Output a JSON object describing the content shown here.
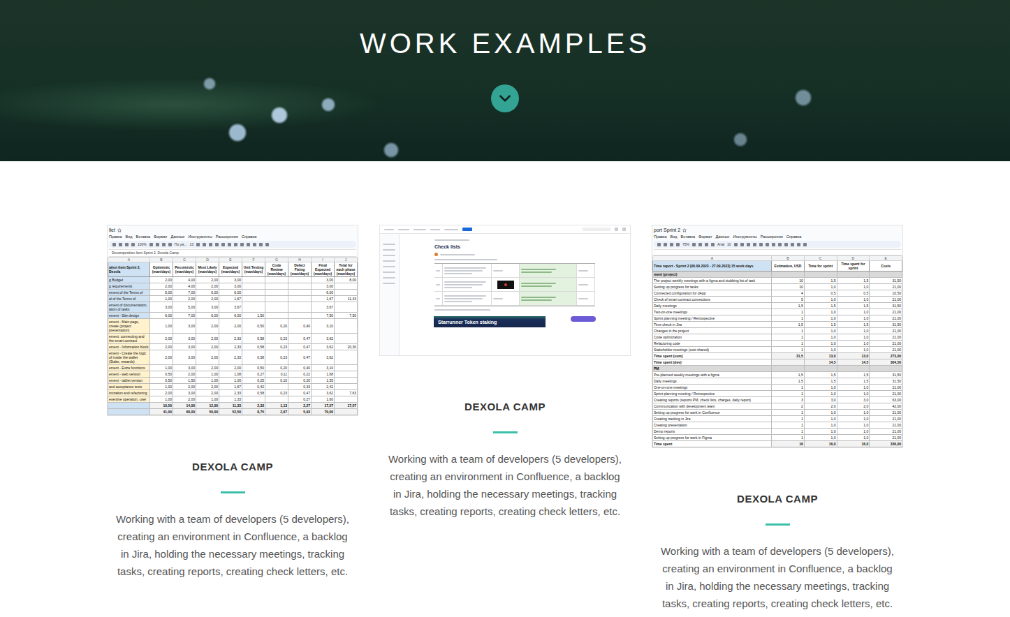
{
  "hero": {
    "title": "WORK EXAMPLES"
  },
  "cards": [
    {
      "title": "DEXOLA CAMP",
      "description": "Working with a team of developers (5 developers), creating an environment in Confluence, a backlog in Jira, holding the necessary meetings, tracking tasks, creating reports, creating check letters, etc.",
      "image": {
        "kind": "sheet",
        "tab": "llet",
        "menu": [
          "Правка",
          "Вид",
          "Вставка",
          "Формат",
          "Данные",
          "Инструменты",
          "Расширения",
          "Справка"
        ],
        "toolbar": {
          "zoom": "100%",
          "font": "По ум...",
          "size": "10"
        },
        "formula": "Decomposition Item Sprint 2, Dexola Camp",
        "letters": [
          "A",
          "B",
          "C",
          "D",
          "E",
          "F",
          "G",
          "H",
          "I",
          "J"
        ],
        "header": [
          "ation Item Sprint 2, Dexola",
          "Optimistic (man/days)",
          "Pessimistic (man/days)",
          "Most Likely (man/days)",
          "Expected (man/days)",
          "Unit Testing (man/days)",
          "Code Review (man/days)",
          "Defect Fixing (man/days)",
          "Final Expected (man/days)",
          "Total for each phase (man/days)"
        ],
        "rows": [
          {
            "kind": "item",
            "color": "#cfe2f3",
            "cells": [
              "g Budget",
              "2,00",
              "4,00",
              "2,00",
              "3,00",
              "",
              "",
              "",
              "3,00",
              "8,00"
            ]
          },
          {
            "kind": "item",
            "color": "#cfe2f3",
            "cells": [
              "g requirements",
              "2,00",
              "4,00",
              "2,00",
              "3,00",
              "",
              "",
              "",
              "3,00",
              ""
            ]
          },
          {
            "kind": "item",
            "color": "#cfe2f3",
            "cells": [
              "ement of the Terms of",
              "5,00",
              "7,00",
              "6,00",
              "6,00",
              "",
              "",
              "",
              "6,00",
              ""
            ]
          },
          {
            "kind": "item",
            "color": "#cfe2f3",
            "cells": [
              "al of the Terms of",
              "1,00",
              "2,00",
              "2,00",
              "1,67",
              "",
              "",
              "",
              "1,67",
              "11,33"
            ]
          },
          {
            "kind": "item",
            "color": "#cfe2f3",
            "cells": [
              "ement of documentation, ation of tasks",
              "3,00",
              "5,00",
              "3,00",
              "3,67",
              "",
              "",
              "",
              "3,67",
              ""
            ]
          },
          {
            "kind": "item",
            "color": "#cfe2f3",
            "cells": [
              "ement - Site design",
              "6,00",
              "7,00",
              "6,00",
              "6,00",
              "1,50",
              "",
              "",
              "7,50",
              "7,50"
            ]
          },
          {
            "kind": "item",
            "color": "#fff2cc",
            "cells": [
              "ement - Main page, create (project presentation)",
              "1,00",
              "3,00",
              "2,00",
              "2,00",
              "0,50",
              "0,20",
              "0,40",
              "3,10",
              ""
            ]
          },
          {
            "kind": "item",
            "color": "#fff2cc",
            "cells": [
              "ement: connecting and the smart contract",
              "2,00",
              "3,00",
              "2,00",
              "2,33",
              "0,58",
              "0,23",
              "0,47",
              "3,62",
              ""
            ]
          },
          {
            "kind": "item",
            "color": "#fff2cc",
            "cells": [
              "ement - Information block",
              "2,00",
              "3,00",
              "2,00",
              "2,33",
              "0,58",
              "0,23",
              "0,47",
              "3,62",
              "20,30"
            ]
          },
          {
            "kind": "item",
            "color": "#fff2cc",
            "cells": [
              "ement - Create the logic of inside the wallet (Stake, rewards)",
              "2,00",
              "3,00",
              "2,00",
              "2,33",
              "0,58",
              "0,23",
              "0,47",
              "3,62",
              ""
            ]
          },
          {
            "kind": "item",
            "color": "#fff2cc",
            "cells": [
              "ement - Extra functions",
              "1,00",
              "3,00",
              "2,00",
              "2,00",
              "0,50",
              "0,20",
              "0,40",
              "3,10",
              ""
            ]
          },
          {
            "kind": "item",
            "color": "#fff2cc",
            "cells": [
              "ement - web version",
              "0,50",
              "2,00",
              "1,00",
              "1,08",
              "0,27",
              "0,11",
              "0,22",
              "1,68",
              ""
            ]
          },
          {
            "kind": "item",
            "color": "#fff2cc",
            "cells": [
              "ement - tablet version",
              "0,50",
              "1,50",
              "1,00",
              "1,00",
              "0,25",
              "0,10",
              "0,20",
              "1,55",
              ""
            ]
          },
          {
            "kind": "item",
            "color": "#fff2cc",
            "cells": [
              "and acceptance tests",
              "1,00",
              "2,00",
              "2,00",
              "1,67",
              "0,42",
              "",
              "0,33",
              "2,42",
              ""
            ]
          },
          {
            "kind": "item",
            "color": "#fff2cc",
            "cells": [
              "imization and refactoring",
              "2,00",
              "3,00",
              "2,00",
              "2,33",
              "0,58",
              "0,23",
              "0,47",
              "3,62",
              "7,63"
            ]
          },
          {
            "kind": "item",
            "color": "#fff2cc",
            "cells": [
              "eventive operation, user",
              "1,00",
              "2,00",
              "1,00",
              "1,33",
              "",
              "",
              "0,27",
              "1,60",
              ""
            ]
          },
          {
            "kind": "total",
            "color": "#cfe2f3",
            "cells": [
              "",
              "10,50",
              "14,00",
              "12,00",
              "11,33",
              "2,33",
              "1,13",
              "2,27",
              "17,57",
              "17,57"
            ]
          },
          {
            "kind": "total",
            "color": "#cfe2f3",
            "cells": [
              "",
              "41,00",
              "68,00",
              "50,00",
              "52,50",
              "8,75",
              "2,67",
              "5,93",
              "70,00",
              ""
            ]
          }
        ]
      }
    },
    {
      "title": "DEXOLA CAMP",
      "description": "Working with a team of developers (5 developers), creating an environment in Confluence, a backlog in Jira, holding the necessary meetings, tracking tasks, creating reports, creating check letters, etc.",
      "image": {
        "kind": "doc",
        "title": "Check lists",
        "banner": "Starrunner Token staking"
      }
    },
    {
      "title": "DEXOLA CAMP",
      "description": "Working with a team of developers (5 developers), creating an environment in Confluence, a backlog in Jira, holding the necessary meetings, tracking tasks, creating reports, creating check letters, etc.",
      "image": {
        "kind": "sheet",
        "tab": "port Sprint 2",
        "menu": [
          "Правка",
          "Вид",
          "Вставка",
          "Формат",
          "Данные",
          "Инструменты",
          "Расширения",
          "Справка"
        ],
        "toolbar": {
          "zoom": "75%",
          "font": "Arial",
          "size": "10"
        },
        "formula": "",
        "letters": [
          "A",
          "B",
          "C",
          "D",
          "E"
        ],
        "header": [
          "Time report - Sprint 2 (06.09.2023 - 27.09.2023) 15 work days",
          "Estimation, USD",
          "Time for sprint",
          "Time spent for sprint",
          "Costs"
        ],
        "rows": [
          {
            "kind": "section",
            "cells": [
              "ment (project)",
              "",
              "",
              "",
              ""
            ]
          },
          {
            "kind": "item",
            "cells": [
              "The project weekly meetings with a figma and stubbing list of task",
              "10",
              "1,5",
              "1,5",
              "31,50"
            ]
          },
          {
            "kind": "item",
            "cells": [
              "Setting up progress for tasks",
              "10",
              "1,0",
              "1,0",
              "21,00"
            ]
          },
          {
            "kind": "item",
            "cells": [
              "Connected configuration for dApp",
              "4",
              "0,5",
              "0,5",
              "10,50"
            ]
          },
          {
            "kind": "item",
            "cells": [
              "Check of smart contract connections",
              "5",
              "1,0",
              "1,0",
              "21,00"
            ]
          },
          {
            "kind": "item",
            "cells": [
              "Daily meetings",
              "1,5",
              "1,5",
              "1,5",
              "31,50"
            ]
          },
          {
            "kind": "item",
            "cells": [
              "Two-on-one meetings",
              "1",
              "1,0",
              "1,0",
              "21,00"
            ]
          },
          {
            "kind": "item",
            "cells": [
              "Sprint planning meeting / Retrospective",
              "1",
              "1,0",
              "1,0",
              "21,00"
            ]
          },
          {
            "kind": "item",
            "cells": [
              "Time check in Jira",
              "1,5",
              "1,5",
              "1,5",
              "31,50"
            ]
          },
          {
            "kind": "item",
            "cells": [
              "Changes in the project",
              "1",
              "1,0",
              "1,0",
              "21,00"
            ]
          },
          {
            "kind": "item",
            "cells": [
              "Code optimization",
              "1",
              "1,0",
              "1,0",
              "21,00"
            ]
          },
          {
            "kind": "item",
            "cells": [
              "Refactoring code",
              "1",
              "1,0",
              "1,0",
              "21,00"
            ]
          },
          {
            "kind": "item",
            "cells": [
              "Stakeholder meetings (cost shared)",
              "1",
              "1,0",
              "1,0",
              "21,00"
            ]
          },
          {
            "kind": "total",
            "cells": [
              "Time spent (sum)",
              "31,5",
              "13,0",
              "13,0",
              "273,00"
            ]
          },
          {
            "kind": "total",
            "cells": [
              "Time spent (dev)",
              "",
              "14,5",
              "14,5",
              "304,50"
            ]
          },
          {
            "kind": "section",
            "cells": [
              "PM",
              "",
              "",
              "",
              ""
            ]
          },
          {
            "kind": "item",
            "cells": [
              "Pre-planned weekly meetings with a figma",
              "1,5",
              "1,5",
              "1,5",
              "31,50"
            ]
          },
          {
            "kind": "item",
            "cells": [
              "Daily meetings",
              "1,5",
              "1,5",
              "1,5",
              "31,50"
            ]
          },
          {
            "kind": "item",
            "cells": [
              "One-on-one meetings",
              "1",
              "1,0",
              "1,0",
              "21,00"
            ]
          },
          {
            "kind": "item",
            "cells": [
              "Sprint planning meeting / Retrospective",
              "1",
              "1,0",
              "1,0",
              "21,00"
            ]
          },
          {
            "kind": "item",
            "cells": [
              "Creating reports (reports PM, check lists, charges, daily report)",
              "3",
              "3,0",
              "3,0",
              "63,00"
            ]
          },
          {
            "kind": "item",
            "cells": [
              "Communication with development team",
              "2",
              "2,0",
              "2,0",
              "42,00"
            ]
          },
          {
            "kind": "item",
            "cells": [
              "Setting up progress for work in Confluence",
              "1",
              "1,0",
              "1,0",
              "21,00"
            ]
          },
          {
            "kind": "item",
            "cells": [
              "Creating tracking in Jira",
              "1",
              "1,0",
              "1,0",
              "21,00"
            ]
          },
          {
            "kind": "item",
            "cells": [
              "Creating presentation",
              "1",
              "1,0",
              "1,0",
              "21,00"
            ]
          },
          {
            "kind": "item",
            "cells": [
              "Demo reports",
              "1",
              "1,0",
              "1,0",
              "21,00"
            ]
          },
          {
            "kind": "item",
            "cells": [
              "Setting up progress for work in Figma",
              "1",
              "1,0",
              "1,0",
              "21,00"
            ]
          },
          {
            "kind": "total",
            "cells": [
              "Time spent",
              "16",
              "16,0",
              "16,0",
              "336,00"
            ]
          }
        ]
      }
    }
  ]
}
